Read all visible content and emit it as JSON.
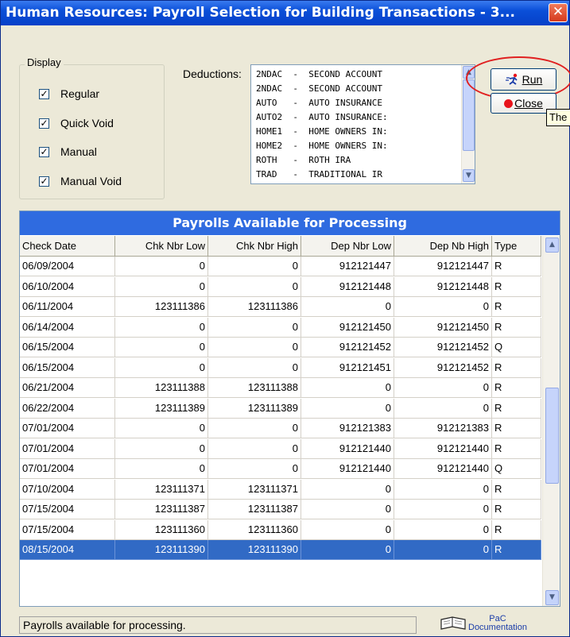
{
  "window": {
    "title": "Human Resources: Payroll Selection for Building Transactions - 3...",
    "close_glyph": "✕"
  },
  "display": {
    "legend": "Display",
    "options": [
      {
        "label": "Regular",
        "checked": true
      },
      {
        "label": "Quick Void",
        "checked": true
      },
      {
        "label": "Manual",
        "checked": true
      },
      {
        "label": "Manual Void",
        "checked": true
      }
    ]
  },
  "deductions": {
    "label": "Deductions:",
    "items": [
      "2NDAC  -  SECOND ACCOUNT",
      "2NDAC  -  SECOND ACCOUNT",
      "AUTO   -  AUTO INSURANCE",
      "AUTO2  -  AUTO INSURANCE:",
      "HOME1  -  HOME OWNERS IN:",
      "HOME2  -  HOME OWNERS IN:",
      "ROTH   -  ROTH IRA",
      "TRAD   -  TRADITIONAL IR"
    ]
  },
  "buttons": {
    "run_label": "Run",
    "close_label": "Close",
    "tooltip": "The"
  },
  "grid": {
    "title": "Payrolls Available for Processing",
    "columns": [
      "Check Date",
      "Chk Nbr Low",
      "Chk Nbr High",
      "Dep Nbr Low",
      "Dep Nb High",
      "Type"
    ],
    "rows": [
      [
        "06/09/2004",
        "0",
        "0",
        "912121447",
        "912121447",
        "R"
      ],
      [
        "06/10/2004",
        "0",
        "0",
        "912121448",
        "912121448",
        "R"
      ],
      [
        "06/11/2004",
        "123111386",
        "123111386",
        "0",
        "0",
        "R"
      ],
      [
        "06/14/2004",
        "0",
        "0",
        "912121450",
        "912121450",
        "R"
      ],
      [
        "06/15/2004",
        "0",
        "0",
        "912121452",
        "912121452",
        "Q"
      ],
      [
        "06/15/2004",
        "0",
        "0",
        "912121451",
        "912121452",
        "R"
      ],
      [
        "06/21/2004",
        "123111388",
        "123111388",
        "0",
        "0",
        "R"
      ],
      [
        "06/22/2004",
        "123111389",
        "123111389",
        "0",
        "0",
        "R"
      ],
      [
        "07/01/2004",
        "0",
        "0",
        "912121383",
        "912121383",
        "R"
      ],
      [
        "07/01/2004",
        "0",
        "0",
        "912121440",
        "912121440",
        "R"
      ],
      [
        "07/01/2004",
        "0",
        "0",
        "912121440",
        "912121440",
        "Q"
      ],
      [
        "07/10/2004",
        "123111371",
        "123111371",
        "0",
        "0",
        "R"
      ],
      [
        "07/15/2004",
        "123111387",
        "123111387",
        "0",
        "0",
        "R"
      ],
      [
        "07/15/2004",
        "123111360",
        "123111360",
        "0",
        "0",
        "R"
      ],
      [
        "08/15/2004",
        "123111390",
        "123111390",
        "0",
        "0",
        "R"
      ]
    ],
    "selected_row": 14
  },
  "status": {
    "text": "Payrolls available for processing."
  },
  "pac": {
    "line1": "PaC",
    "line2": "Documentation",
    "icon": "book-icon"
  },
  "colors": {
    "title_blue": "#0a4fd8",
    "grid_title": "#2f6be0",
    "selection": "#316ac5",
    "highlight_circle": "#e02020"
  }
}
